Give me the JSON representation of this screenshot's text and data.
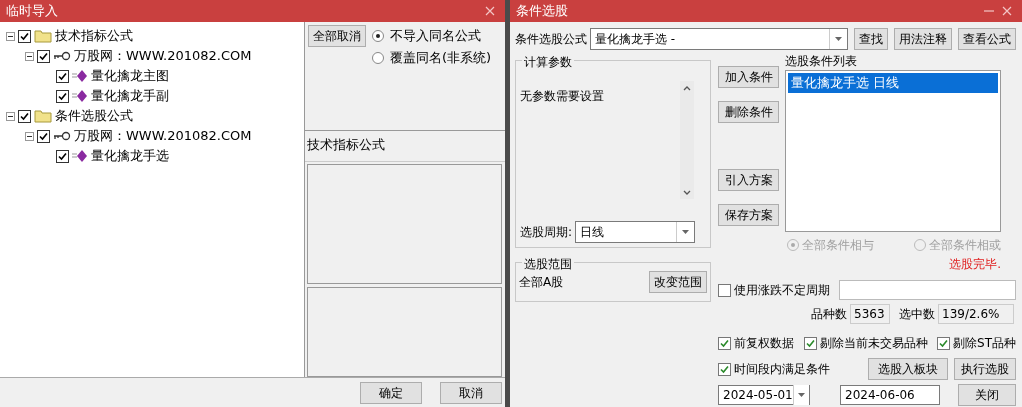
{
  "import_window": {
    "title": "临时导入",
    "tree": [
      {
        "label": "技术指标公式",
        "kind": "folder",
        "checked": true,
        "expanded": true,
        "children": [
          {
            "label": "万股网：WWW.201082.COM",
            "kind": "key",
            "checked": true,
            "expanded": true,
            "children": [
              {
                "label": "量化擒龙主图",
                "kind": "formula",
                "checked": true
              },
              {
                "label": "量化擒龙手副",
                "kind": "formula",
                "checked": true
              }
            ]
          }
        ]
      },
      {
        "label": "条件选股公式",
        "kind": "folder",
        "checked": true,
        "expanded": true,
        "children": [
          {
            "label": "万股网：WWW.201082.COM",
            "kind": "key",
            "checked": true,
            "expanded": true,
            "children": [
              {
                "label": "量化擒龙手选",
                "kind": "formula",
                "checked": true
              }
            ]
          }
        ]
      }
    ],
    "clear_button": "全部取消",
    "options": [
      {
        "label": "不导入同名公式",
        "selected": true
      },
      {
        "label": "覆盖同名(非系统)",
        "selected": false
      }
    ],
    "category_label": "技术指标公式",
    "buttons": [
      "确定",
      "取消"
    ]
  },
  "screener_window": {
    "title": "条件选股",
    "formula_label": "条件选股公式",
    "formula_value": "量化擒龙手选  -",
    "top_buttons": [
      "查找",
      "用法注释",
      "查看公式"
    ],
    "params_group": {
      "title": "计算参数",
      "message": "无参数需要设置"
    },
    "period_label": "选股周期:",
    "period_value": "日线",
    "scope_group": {
      "title": "选股范围",
      "value": "全部A股",
      "button": "改变范围"
    },
    "side_buttons": [
      "加入条件",
      "删除条件",
      "引入方案",
      "保存方案"
    ],
    "condition_list": {
      "title": "选股条件列表",
      "items": [
        {
          "label": "量化擒龙手选  日线",
          "selected": true
        }
      ]
    },
    "logic_options": [
      {
        "label": "全部条件相与",
        "selected": true,
        "disabled": true
      },
      {
        "label": "全部条件相或",
        "selected": false,
        "disabled": true
      }
    ],
    "status": "选股完毕.",
    "variable_period": {
      "label": "使用涨跌不定周期",
      "checked": false
    },
    "count_label": "品种数",
    "count_value": "5363",
    "selected_label": "选中数",
    "selected_value": "139/2.6%",
    "filters": [
      {
        "label": "前复权数据",
        "checked": true
      },
      {
        "label": "剔除当前未交易品种",
        "checked": true
      },
      {
        "label": "剔除ST品种",
        "checked": true
      }
    ],
    "period_filter": {
      "label": "时间段内满足条件",
      "checked": true
    },
    "action_buttons": [
      "选股入板块",
      "执行选股"
    ],
    "start_date": "2024-05-01",
    "end_date": "2024-06-06",
    "close_button": "关闭"
  }
}
